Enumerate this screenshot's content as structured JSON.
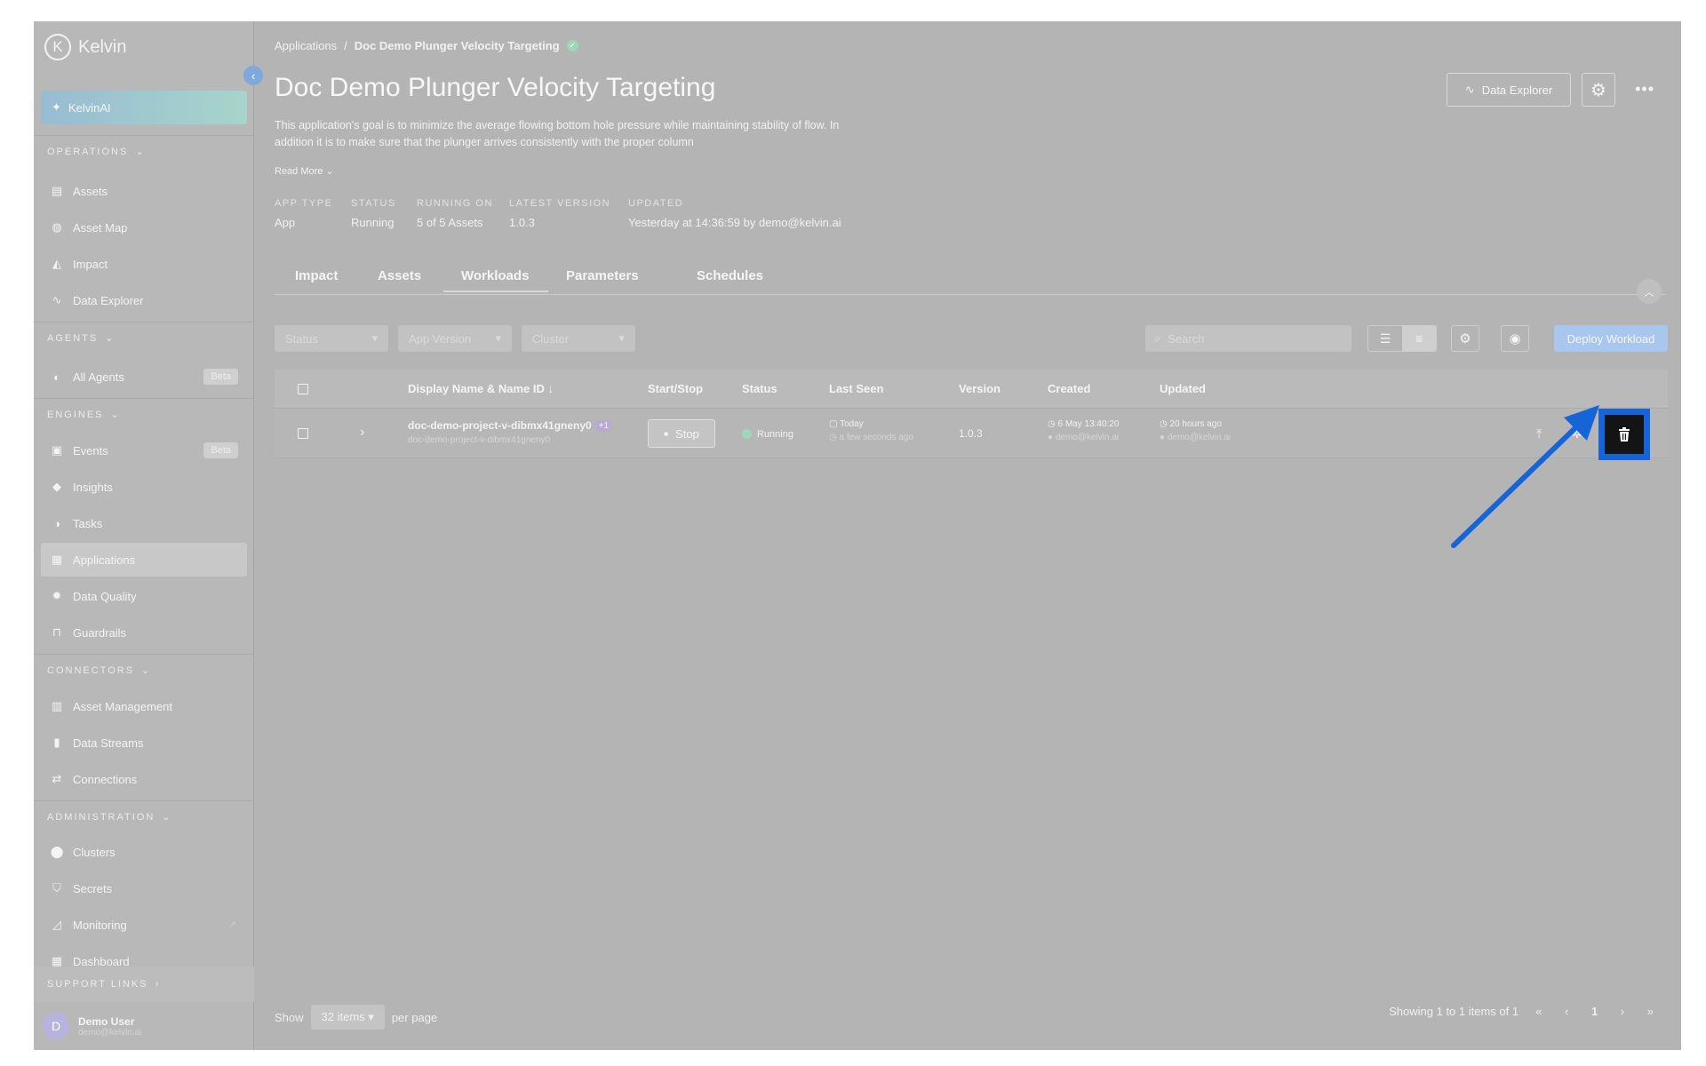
{
  "sidebar": {
    "logo": "Kelvin",
    "kelvinai": "KelvinAI",
    "sections": [
      {
        "label": "OPERATIONS",
        "items": [
          "Assets",
          "Asset Map",
          "Impact",
          "Data Explorer"
        ]
      },
      {
        "label": "AGENTS",
        "items": [
          "All Agents"
        ]
      },
      {
        "label": "ENGINES",
        "items": [
          "Events",
          "Insights",
          "Tasks",
          "Applications",
          "Data Quality",
          "Guardrails"
        ]
      },
      {
        "label": "CONNECTORS",
        "items": [
          "Asset Management",
          "Data Streams",
          "Connections"
        ]
      },
      {
        "label": "ADMINISTRATION",
        "items": [
          "Clusters",
          "Secrets",
          "Monitoring",
          "Dashboard"
        ]
      }
    ],
    "beta_label": "Beta",
    "support_links": "SUPPORT LINKS",
    "user": {
      "initial": "D",
      "name": "Demo User",
      "email": "demo@kelvin.ai"
    }
  },
  "header": {
    "breadcrumb_root": "Applications",
    "breadcrumb_current": "Doc Demo Plunger Velocity Targeting",
    "title": "Doc Demo Plunger Velocity Targeting",
    "description": "This application's goal is to minimize the average flowing bottom hole pressure while maintaining stability of flow. In addition it is to make sure that the plunger arrives consistently with the proper column",
    "read_more": "Read More",
    "data_explorer_btn": "Data Explorer"
  },
  "meta": [
    {
      "label": "APP TYPE",
      "value": "App"
    },
    {
      "label": "STATUS",
      "value": "Running"
    },
    {
      "label": "RUNNING ON",
      "value": "5 of 5 Assets"
    },
    {
      "label": "LATEST VERSION",
      "value": "1.0.3"
    },
    {
      "label": "UPDATED",
      "value": "Yesterday at 14:36:59 by demo@kelvin.ai"
    }
  ],
  "tabs": [
    "Impact",
    "Assets",
    "Workloads",
    "Parameters",
    "Schedules"
  ],
  "active_tab": "Workloads",
  "filters": {
    "status": "Status",
    "app_version": "App Version",
    "cluster": "Cluster",
    "search_placeholder": "Search",
    "deploy": "Deploy Workload"
  },
  "table": {
    "columns": [
      "Display Name & Name ID",
      "Start/Stop",
      "Status",
      "Last Seen",
      "Version",
      "Created",
      "Updated"
    ],
    "sort_indicator": "↓",
    "rows": [
      {
        "name": "doc-demo-project-v-dibmx41gneny0",
        "name_id": "doc-demo-project-v-dibmx41gneny0",
        "extra": "+1",
        "action": "Stop",
        "status": "Running",
        "last_seen_day": "Today",
        "last_seen_rel": "a few seconds ago",
        "version": "1.0.3",
        "created_date": "6 May 13:40:20",
        "created_by": "demo@kelvin.ai",
        "updated_rel": "20 hours ago",
        "updated_by": "demo@kelvin.ai"
      }
    ]
  },
  "pagination": {
    "show": "Show",
    "per_page_value": "32 items",
    "per_page": "per page",
    "summary": "Showing 1 to 1 items of 1",
    "current_page": "1"
  },
  "colors": {
    "highlight": "#1565d8",
    "primary_button": "#a9c7ee",
    "status_ok": "#9fd6b6"
  }
}
